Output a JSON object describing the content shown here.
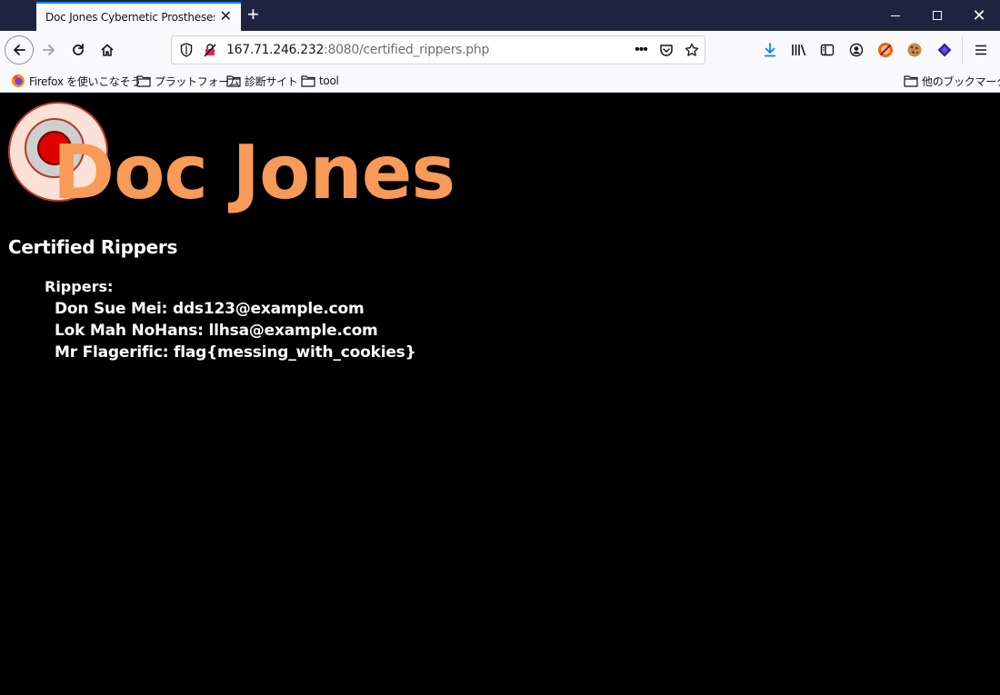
{
  "browser": {
    "tab": {
      "title": "Doc Jones Cybernetic Prostheses In"
    },
    "window_controls": {
      "minimize": "minimize",
      "maximize": "maximize",
      "close": "✕"
    },
    "url": {
      "host": "167.71.246.232",
      "rest": ":8080/certified_rippers.php"
    },
    "bookmarks": [
      {
        "label": "Firefox を使いこなそう",
        "icon": "firefox-icon"
      },
      {
        "label": "プラットフォーム",
        "icon": "folder-icon"
      },
      {
        "label": "診断サイト",
        "icon": "folder-icon"
      },
      {
        "label": "tool",
        "icon": "folder-icon"
      }
    ],
    "other_bookmarks": "他のブックマーク"
  },
  "page": {
    "logo_text": "Doc Jones",
    "heading": "Certified Rippers",
    "rippers_label": "Rippers:",
    "rippers": [
      "Don Sue Mei: dds123@example.com",
      "Lok Mah NoHans: llhsa@example.com",
      "Mr Flagerific: flag{messing_with_cookies}"
    ]
  },
  "colors": {
    "logo_orange": "#f89a58",
    "titlebar": "#202340",
    "page_bg": "#000000"
  }
}
